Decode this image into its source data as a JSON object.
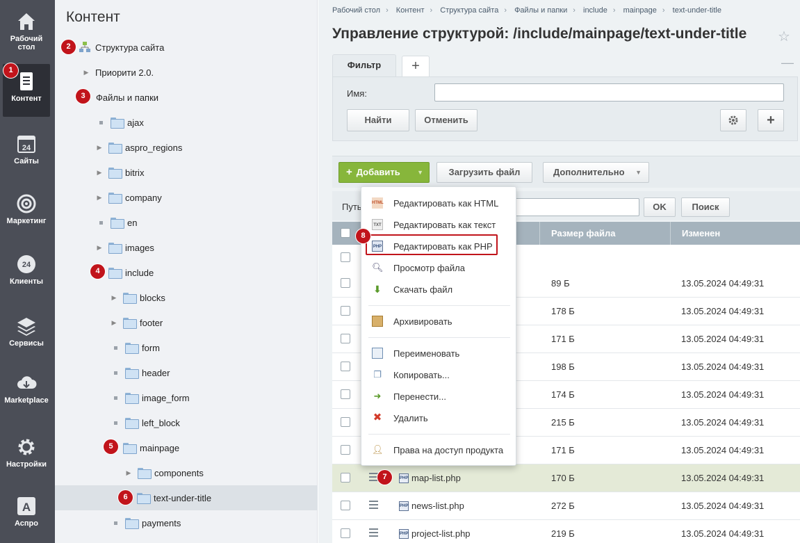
{
  "rail": {
    "items": [
      {
        "label": "Рабочий стол",
        "icon": "home-icon"
      },
      {
        "label": "Контент",
        "icon": "document-icon"
      },
      {
        "label": "Сайты",
        "icon": "calendar-24-icon"
      },
      {
        "label": "Маркетинг",
        "icon": "target-icon"
      },
      {
        "label": "Клиенты",
        "icon": "clients-24-icon"
      },
      {
        "label": "Сервисы",
        "icon": "layers-icon"
      },
      {
        "label": "Marketplace",
        "icon": "cloud-download-icon"
      },
      {
        "label": "Настройки",
        "icon": "gear-icon"
      },
      {
        "label": "Аспро",
        "icon": "aspro-a-icon"
      }
    ]
  },
  "tree": {
    "title": "Контент",
    "nodes": [
      {
        "label": "Структура сайта"
      },
      {
        "label": "Приорити 2.0."
      },
      {
        "label": "Файлы и папки"
      },
      {
        "label": "ajax"
      },
      {
        "label": "aspro_regions"
      },
      {
        "label": "bitrix"
      },
      {
        "label": "company"
      },
      {
        "label": "en"
      },
      {
        "label": "images"
      },
      {
        "label": "include"
      },
      {
        "label": "blocks"
      },
      {
        "label": "footer"
      },
      {
        "label": "form"
      },
      {
        "label": "header"
      },
      {
        "label": "image_form"
      },
      {
        "label": "left_block"
      },
      {
        "label": "mainpage"
      },
      {
        "label": "components"
      },
      {
        "label": "text-under-title"
      },
      {
        "label": "payments"
      }
    ]
  },
  "badges": [
    "1",
    "2",
    "3",
    "4",
    "5",
    "6",
    "7",
    "8"
  ],
  "breadcrumbs": [
    "Рабочий стол",
    "Контент",
    "Структура сайта",
    "Файлы и папки",
    "include",
    "mainpage",
    "text-under-title"
  ],
  "page_title": "Управление структурой: /include/mainpage/text-under-title",
  "filter": {
    "tab_label": "Фильтр",
    "name_label": "Имя:",
    "name_value": "",
    "find_label": "Найти",
    "cancel_label": "Отменить"
  },
  "toolbar": {
    "add_label": "Добавить",
    "upload_label": "Загрузить файл",
    "more_label": "Дополнительно"
  },
  "pathbar": {
    "label": "Путь",
    "ok_label": "OK",
    "search_label": "Поиск"
  },
  "table": {
    "columns": [
      "Размер файла",
      "Изменен"
    ],
    "rows": [
      {
        "name": "",
        "size": "",
        "date": ""
      },
      {
        "name": "",
        "size": "89 Б",
        "date": "13.05.2024 04:49:31"
      },
      {
        "name": "",
        "size": "178 Б",
        "date": "13.05.2024 04:49:31"
      },
      {
        "name": "",
        "size": "171 Б",
        "date": "13.05.2024 04:49:31"
      },
      {
        "name": "",
        "size": "198 Б",
        "date": "13.05.2024 04:49:31"
      },
      {
        "name": "",
        "size": "174 Б",
        "date": "13.05.2024 04:49:31"
      },
      {
        "name": "",
        "size": "215 Б",
        "date": "13.05.2024 04:49:31"
      },
      {
        "name": "",
        "size": "171 Б",
        "date": "13.05.2024 04:49:31"
      },
      {
        "name": "map-list.php",
        "size": "170 Б",
        "date": "13.05.2024 04:49:31"
      },
      {
        "name": "news-list.php",
        "size": "272 Б",
        "date": "13.05.2024 04:49:31"
      },
      {
        "name": "project-list.php",
        "size": "219 Б",
        "date": "13.05.2024 04:49:31"
      }
    ]
  },
  "context_menu": {
    "items": [
      {
        "label": "Редактировать как HTML",
        "icon": "html-file-icon"
      },
      {
        "label": "Редактировать как текст",
        "icon": "txt-file-icon"
      },
      {
        "label": "Редактировать как PHP",
        "icon": "php-file-icon"
      },
      {
        "label": "Просмотр файла",
        "icon": "magnifier-icon"
      },
      {
        "label": "Скачать файл",
        "icon": "download-icon"
      },
      {
        "label": "Архивировать",
        "icon": "archive-box-icon"
      },
      {
        "label": "Переименовать",
        "icon": "rename-icon"
      },
      {
        "label": "Копировать...",
        "icon": "copy-icon"
      },
      {
        "label": "Перенести...",
        "icon": "move-icon"
      },
      {
        "label": "Удалить",
        "icon": "delete-x-icon"
      },
      {
        "label": "Права на доступ продукта",
        "icon": "user-lock-icon"
      }
    ]
  },
  "colors": {
    "rail": "#4b4e57",
    "accent_green": "#87b63b",
    "badge_red": "#c1141b",
    "table_header": "#a5b3bd",
    "row_highlight": "#e4ead7"
  }
}
